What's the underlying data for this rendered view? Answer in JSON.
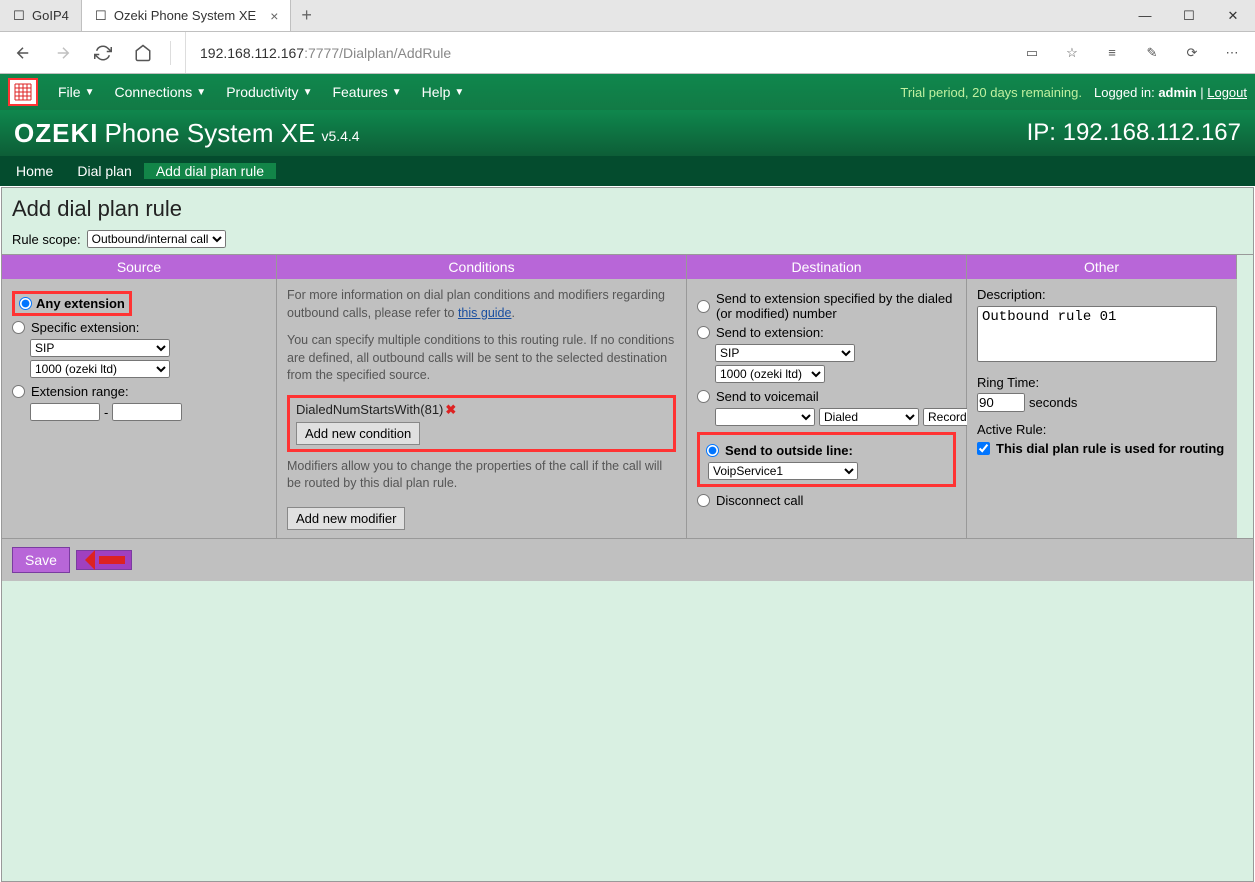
{
  "tabs": {
    "t0": "GoIP4",
    "t1": "Ozeki Phone System XE"
  },
  "address": {
    "host": "192.168.112.167",
    "port": ":7777",
    "path": "/Dialplan/AddRule"
  },
  "menu": {
    "file": "File",
    "conn": "Connections",
    "prod": "Productivity",
    "feat": "Features",
    "help": "Help"
  },
  "trial": "Trial period, 20 days remaining.",
  "login": {
    "prefix": "Logged in: ",
    "user": "admin",
    "sep": " | ",
    "logout": "Logout"
  },
  "brand": {
    "ozeki": "OZEKI",
    "product": "Phone System XE",
    "version": "v5.4.4",
    "ip": "IP: 192.168.112.167"
  },
  "crumbs": {
    "home": "Home",
    "dialplan": "Dial plan",
    "addrule": "Add dial plan rule"
  },
  "page": {
    "title": "Add dial plan rule",
    "scope_label": "Rule scope:",
    "scope_value": "Outbound/internal call"
  },
  "cols": {
    "source": "Source",
    "conditions": "Conditions",
    "destination": "Destination",
    "other": "Other"
  },
  "source": {
    "any": "Any extension",
    "specific": "Specific extension:",
    "sip": "SIP",
    "ext": "1000 (ozeki ltd)",
    "range": "Extension range:",
    "dash": "-"
  },
  "conditions": {
    "info1": "For more information on dial plan conditions and modifiers regarding outbound calls, please refer to ",
    "info1_link": "this guide",
    "info2": "You can specify multiple conditions to this routing rule. If no conditions are defined, all outbound calls will be sent to the selected destination from the specified source.",
    "tag": "DialedNumStartsWith(81)",
    "add_cond": "Add new condition",
    "info3": "Modifiers allow you to change the properties of the call if the call will be routed by this dial plan rule.",
    "add_mod": "Add new modifier"
  },
  "dest": {
    "opt1": "Send to extension specified by the dialed (or modified) number",
    "opt2": "Send to extension:",
    "sip": "SIP",
    "ext": "1000 (ozeki ltd)",
    "opt3": "Send to voicemail",
    "dialed": "Dialed",
    "record": "Record",
    "opt4": "Send to outside line:",
    "voip": "VoipService1",
    "opt5": "Disconnect call"
  },
  "other": {
    "desc_label": "Description:",
    "desc_value": "Outbound rule 01",
    "ring_label": "Ring Time:",
    "ring_value": "90",
    "seconds": "seconds",
    "active_label": "Active Rule:",
    "active_text": "This dial plan rule is used for routing"
  },
  "save": "Save"
}
